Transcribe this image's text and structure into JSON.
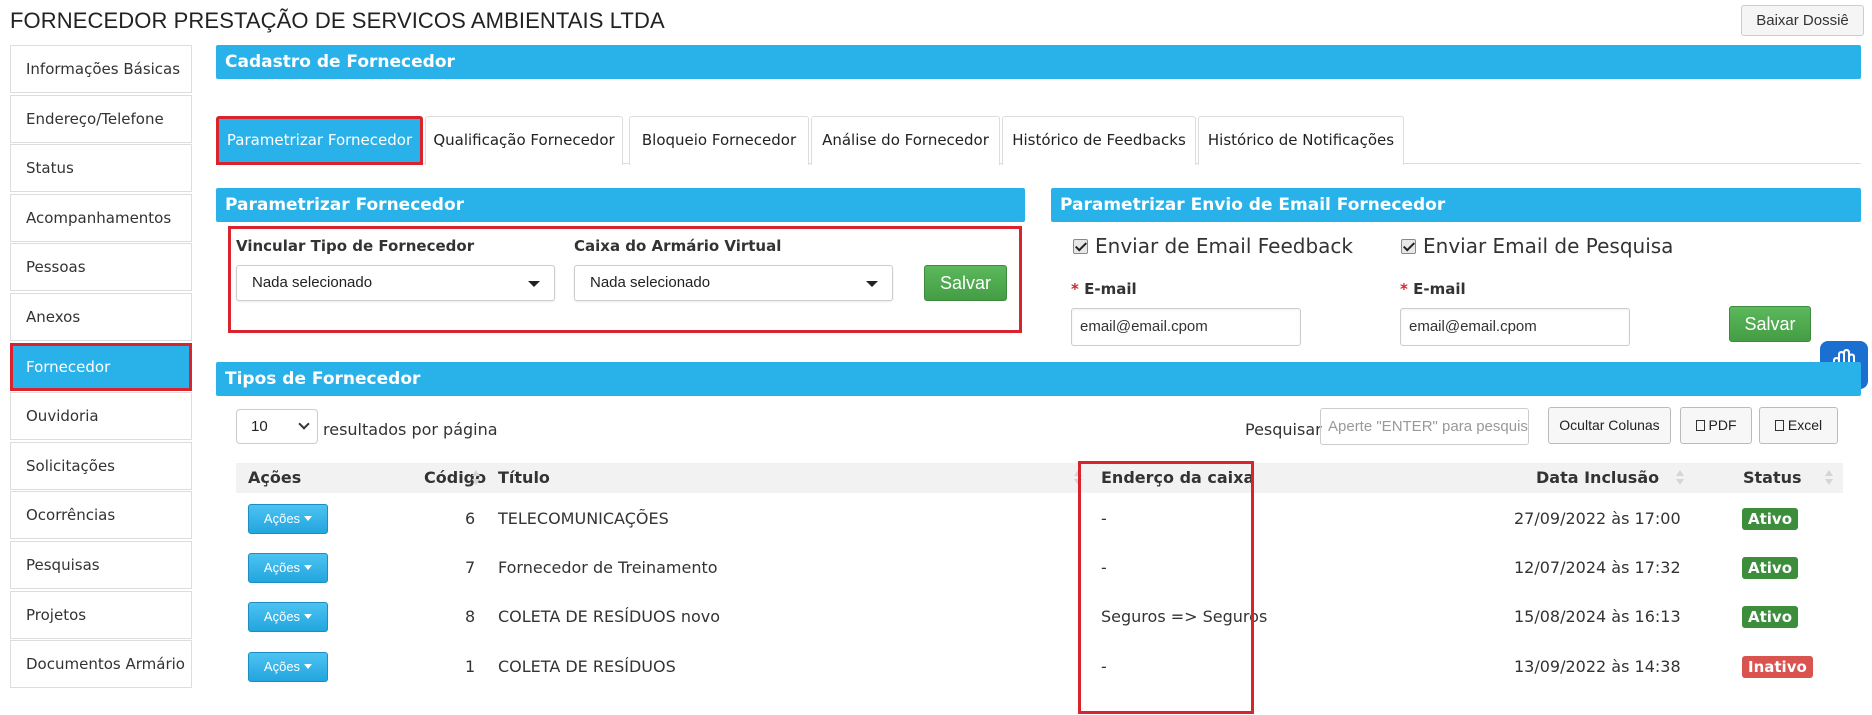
{
  "header": {
    "title": "FORNECEDOR PRESTAÇÃO DE SERVICOS AMBIENTAIS LTDA",
    "download_button": "Baixar Dossiê"
  },
  "sidebar": {
    "items": [
      {
        "label": "Informações Básicas"
      },
      {
        "label": "Endereço/Telefone"
      },
      {
        "label": "Status"
      },
      {
        "label": "Acompanhamentos"
      },
      {
        "label": "Pessoas"
      },
      {
        "label": "Anexos"
      },
      {
        "label": "Fornecedor",
        "active": true
      },
      {
        "label": "Ouvidoria"
      },
      {
        "label": "Solicitações"
      },
      {
        "label": "Ocorrências"
      },
      {
        "label": "Pesquisas"
      },
      {
        "label": "Projetos"
      },
      {
        "label": "Documentos Armário"
      }
    ]
  },
  "main": {
    "title": "Cadastro de Fornecedor",
    "tabs": [
      {
        "label": "Parametrizar Fornecedor",
        "active": true
      },
      {
        "label": "Qualificação Fornecedor"
      },
      {
        "label": "Bloqueio Fornecedor"
      },
      {
        "label": "Análise do Fornecedor"
      },
      {
        "label": "Histórico de Feedbacks"
      },
      {
        "label": "Histórico de Notificações"
      }
    ]
  },
  "param": {
    "title": "Parametrizar Fornecedor",
    "tipo_label": "Vincular Tipo de Fornecedor",
    "tipo_value": "Nada selecionado",
    "caixa_label": "Caixa do Armário Virtual",
    "caixa_value": "Nada selecionado",
    "save": "Salvar"
  },
  "email": {
    "title": "Parametrizar Envio de Email Fornecedor",
    "feedback_check": "Enviar de Email Feedback",
    "pesquisa_check": "Enviar Email de Pesquisa",
    "required_mark": "*",
    "email_label": "E-mail",
    "email1_value": "email@email.cpom",
    "email2_value": "email@email.cpom",
    "save": "Salvar"
  },
  "tipos": {
    "title": "Tipos de Fornecedor",
    "page_length": "10",
    "page_length_text": "resultados por página",
    "search_label": "Pesquisar",
    "search_placeholder": "Aperte \"ENTER\" para pesquisar",
    "btn_hide_cols": "Ocultar Colunas",
    "btn_pdf": "PDF",
    "btn_excel": "Excel",
    "columns": [
      "Ações",
      "Código",
      "Título",
      "Enderço da caixa",
      "Data Inclusão",
      "Status"
    ],
    "action_label": "Ações",
    "rows": [
      {
        "codigo": "6",
        "titulo": "TELECOMUNICAÇÕES",
        "endereco": "-",
        "data": "27/09/2022 às 17:00",
        "status": "Ativo",
        "status_color": "#3c8d3c"
      },
      {
        "codigo": "7",
        "titulo": "Fornecedor de Treinamento",
        "endereco": "-",
        "data": "12/07/2024 às 17:32",
        "status": "Ativo",
        "status_color": "#3c8d3c"
      },
      {
        "codigo": "8",
        "titulo": "COLETA DE RESÍDUOS novo",
        "endereco": "Seguros => Seguros",
        "data": "15/08/2024 às 16:13",
        "status": "Ativo",
        "status_color": "#3c8d3c"
      },
      {
        "codigo": "1",
        "titulo": "COLETA DE RESÍDUOS",
        "endereco": "-",
        "data": "13/09/2022 às 14:38",
        "status": "Inativo",
        "status_color": "#d9534f"
      }
    ]
  },
  "colors": {
    "accent": "#29b2ea",
    "highlight": "#d9232d",
    "save_green": "#5cb85c"
  }
}
